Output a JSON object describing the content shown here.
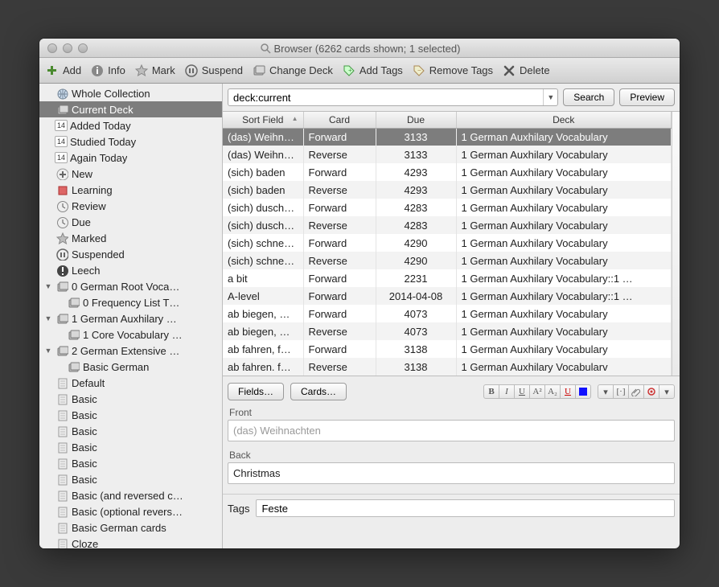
{
  "window_title": "Browser (6262 cards shown; 1 selected)",
  "toolbar": [
    {
      "id": "add",
      "label": "Add",
      "icon": "plus"
    },
    {
      "id": "info",
      "label": "Info",
      "icon": "info"
    },
    {
      "id": "mark",
      "label": "Mark",
      "icon": "star"
    },
    {
      "id": "suspend",
      "label": "Suspend",
      "icon": "pause"
    },
    {
      "id": "changedeck",
      "label": "Change Deck",
      "icon": "deck"
    },
    {
      "id": "addtags",
      "label": "Add Tags",
      "icon": "tagplus"
    },
    {
      "id": "removetags",
      "label": "Remove Tags",
      "icon": "tagminus"
    },
    {
      "id": "delete",
      "label": "Delete",
      "icon": "x"
    }
  ],
  "sidebar": [
    {
      "label": "Whole Collection",
      "icon": "globe",
      "indent": 0,
      "sel": false
    },
    {
      "label": "Current Deck",
      "icon": "deck",
      "indent": 0,
      "sel": true
    },
    {
      "label": "Added Today",
      "icon": "cal",
      "indent": 0,
      "badge": "14"
    },
    {
      "label": "Studied Today",
      "icon": "cal",
      "indent": 0,
      "badge": "14"
    },
    {
      "label": "Again Today",
      "icon": "cal",
      "indent": 0,
      "badge": "14"
    },
    {
      "label": "New",
      "icon": "plus2",
      "indent": 0
    },
    {
      "label": "Learning",
      "icon": "sq",
      "indent": 0
    },
    {
      "label": "Review",
      "icon": "clock",
      "indent": 0
    },
    {
      "label": "Due",
      "icon": "clock",
      "indent": 0
    },
    {
      "label": "Marked",
      "icon": "star",
      "indent": 0
    },
    {
      "label": "Suspended",
      "icon": "pause",
      "indent": 0
    },
    {
      "label": "Leech",
      "icon": "warn",
      "indent": 0
    },
    {
      "label": "0 German Root Voca…",
      "icon": "deck",
      "indent": 0,
      "disc": "▼"
    },
    {
      "label": "0 Frequency List T…",
      "icon": "deck",
      "indent": 1
    },
    {
      "label": "1 German Auxhilary …",
      "icon": "deck",
      "indent": 0,
      "disc": "▼"
    },
    {
      "label": "1 Core Vocabulary …",
      "icon": "deck",
      "indent": 1
    },
    {
      "label": "2 German Extensive …",
      "icon": "deck",
      "indent": 0,
      "disc": "▼"
    },
    {
      "label": "Basic German",
      "icon": "deck",
      "indent": 1
    },
    {
      "label": "Default",
      "icon": "note",
      "indent": 0
    },
    {
      "label": "Basic",
      "icon": "note",
      "indent": 0
    },
    {
      "label": "Basic",
      "icon": "note",
      "indent": 0
    },
    {
      "label": "Basic",
      "icon": "note",
      "indent": 0
    },
    {
      "label": "Basic",
      "icon": "note",
      "indent": 0
    },
    {
      "label": "Basic",
      "icon": "note",
      "indent": 0
    },
    {
      "label": "Basic",
      "icon": "note",
      "indent": 0
    },
    {
      "label": "Basic (and reversed c…",
      "icon": "note",
      "indent": 0
    },
    {
      "label": "Basic (optional revers…",
      "icon": "note",
      "indent": 0
    },
    {
      "label": "Basic German cards",
      "icon": "note",
      "indent": 0
    },
    {
      "label": "Cloze",
      "icon": "note",
      "indent": 0
    }
  ],
  "search": {
    "value": "deck:current",
    "search_btn": "Search",
    "preview_btn": "Preview"
  },
  "columns": {
    "sort": "Sort Field",
    "card": "Card",
    "due": "Due",
    "deck": "Deck"
  },
  "rows": [
    {
      "sort": "(das) Weihn…",
      "card": "Forward",
      "due": "3133",
      "deck": "1 German Auxhilary Vocabulary",
      "sel": true
    },
    {
      "sort": "(das) Weihn…",
      "card": "Reverse",
      "due": "3133",
      "deck": "1 German Auxhilary Vocabulary"
    },
    {
      "sort": "(sich) baden",
      "card": "Forward",
      "due": "4293",
      "deck": "1 German Auxhilary Vocabulary"
    },
    {
      "sort": "(sich) baden",
      "card": "Reverse",
      "due": "4293",
      "deck": "1 German Auxhilary Vocabulary"
    },
    {
      "sort": "(sich) dusch…",
      "card": "Forward",
      "due": "4283",
      "deck": "1 German Auxhilary Vocabulary"
    },
    {
      "sort": "(sich) dusch…",
      "card": "Reverse",
      "due": "4283",
      "deck": "1 German Auxhilary Vocabulary"
    },
    {
      "sort": "(sich) schne…",
      "card": "Forward",
      "due": "4290",
      "deck": "1 German Auxhilary Vocabulary"
    },
    {
      "sort": "(sich) schne…",
      "card": "Reverse",
      "due": "4290",
      "deck": "1 German Auxhilary Vocabulary"
    },
    {
      "sort": "a bit",
      "card": "Forward",
      "due": "2231",
      "deck": "1 German Auxhilary Vocabulary::1 …"
    },
    {
      "sort": "A-level",
      "card": "Forward",
      "due": "2014-04-08",
      "deck": "1 German Auxhilary Vocabulary::1 …"
    },
    {
      "sort": "ab biegen, …",
      "card": "Forward",
      "due": "4073",
      "deck": "1 German Auxhilary Vocabulary"
    },
    {
      "sort": "ab biegen, …",
      "card": "Reverse",
      "due": "4073",
      "deck": "1 German Auxhilary Vocabulary"
    },
    {
      "sort": "ab fahren, f…",
      "card": "Forward",
      "due": "3138",
      "deck": "1 German Auxhilary Vocabulary"
    },
    {
      "sort": "ab fahren. f…",
      "card": "Reverse",
      "due": "3138",
      "deck": "1 German Auxhilary Vocabularv"
    }
  ],
  "editor": {
    "fields_btn": "Fields…",
    "cards_btn": "Cards…",
    "front_label": "Front",
    "front_value": "(das) Weihnachten",
    "back_label": "Back",
    "back_value": "Christmas",
    "tags_label": "Tags",
    "tags_value": "Feste"
  }
}
